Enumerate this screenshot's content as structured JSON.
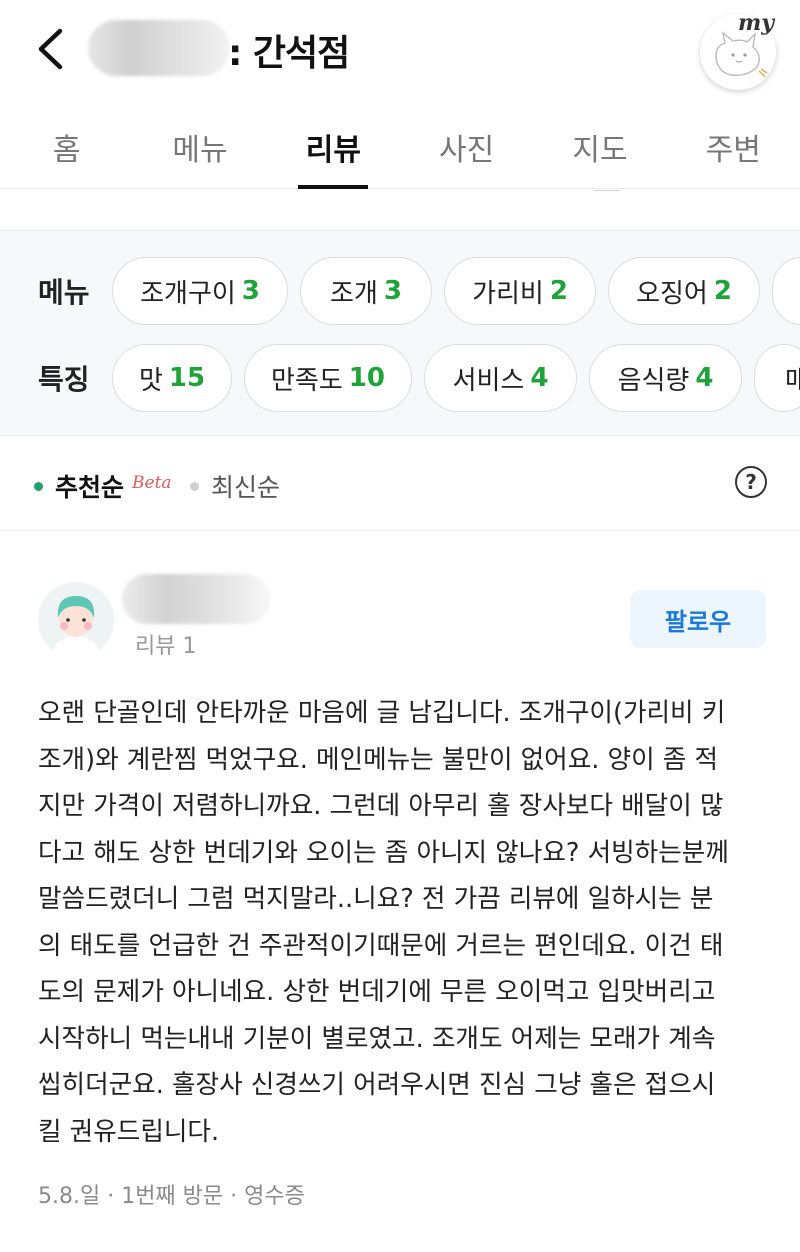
{
  "header": {
    "title_suffix": ": 간석점",
    "my_badge": "my"
  },
  "tabs": [
    {
      "label": "홈",
      "active": false
    },
    {
      "label": "메뉴",
      "active": false
    },
    {
      "label": "리뷰",
      "active": true
    },
    {
      "label": "사진",
      "active": false
    },
    {
      "label": "지도",
      "active": false
    },
    {
      "label": "주변",
      "active": false
    }
  ],
  "filters": {
    "menu_label": "메뉴",
    "menu_chips": [
      {
        "name": "조개구이",
        "count": "3"
      },
      {
        "name": "조개",
        "count": "3"
      },
      {
        "name": "가리비",
        "count": "2"
      },
      {
        "name": "오징어",
        "count": "2"
      }
    ],
    "feature_label": "특징",
    "feature_chips": [
      {
        "name": "맛",
        "count": "15"
      },
      {
        "name": "만족도",
        "count": "10"
      },
      {
        "name": "서비스",
        "count": "4"
      },
      {
        "name": "음식량",
        "count": "4"
      }
    ],
    "partial_feature_chip": "매"
  },
  "sort": {
    "recommended": "추천순",
    "beta": "Beta",
    "latest": "최신순",
    "help": "?"
  },
  "review": {
    "review_count": "리뷰 1",
    "follow_label": "팔로우",
    "body_lines": [
      "오랜 단골인데 안타까운 마음에 글 남깁니다. 조개구이(가리비 키",
      "조개)와 계란찜 먹었구요. 메인메뉴는 불만이 없어요. 양이 좀 적",
      "지만 가격이 저렴하니까요. 그런데 아무리 홀 장사보다 배달이 많",
      "다고 해도 상한 번데기와 오이는 좀 아니지 않나요? 서빙하는분께",
      "말씀드렸더니 그럼 먹지말라..니요? 전 가끔 리뷰에 일하시는 분",
      "의 태도를 언급한 건 주관적이기때문에 거르는 편인데요. 이건 태",
      "도의 문제가 아니네요. 상한 번데기에 무른 오이먹고 입맛버리고",
      "시작하니 먹는내내 기분이 별로였고. 조개도 어제는 모래가 계속",
      "씹히더군요. 홀장사 신경쓰기 어려우시면 진심 그냥 홀은 접으시",
      "킬 권유드립니다."
    ],
    "meta": "5.8.일 · 1번째 방문 · 영수증"
  },
  "colors": {
    "count_green": "#1fa33a",
    "follow_blue": "#1a79d8",
    "beta_red": "#e25a5a",
    "filter_bg": "#f6f8fa"
  }
}
